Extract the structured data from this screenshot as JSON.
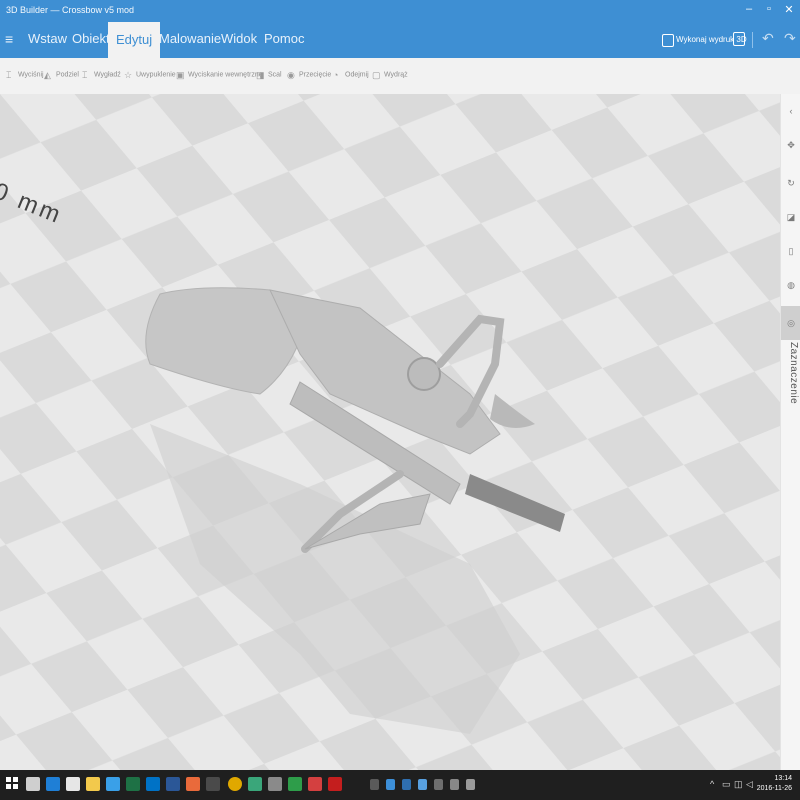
{
  "window": {
    "title": "3D Builder — Crossbow v5 mod",
    "controls": [
      "–",
      "▫",
      "✕"
    ]
  },
  "menu": {
    "hamburger": "≡",
    "tabs": [
      "Wstaw",
      "Obiekt",
      "Edytuj",
      "Malowanie",
      "Widok",
      "Pomoc"
    ],
    "active_tab": "Edytuj",
    "share_label": "Wykonaj wydruk 3D",
    "undo": "↶",
    "redo": "↷"
  },
  "toolbar": {
    "items": [
      {
        "label": "Wyciśnij",
        "icon": "extrude-icon"
      },
      {
        "label": "Podziel",
        "icon": "split-icon"
      },
      {
        "label": "Wygładź",
        "icon": "smooth-icon"
      },
      {
        "label": "Uwypuklenie",
        "icon": "emboss-icon"
      },
      {
        "label": "Wyciskanie wewnętrzne",
        "icon": "extrude-down-icon"
      },
      {
        "label": "Scal",
        "icon": "merge-icon"
      },
      {
        "label": "Przecięcie",
        "icon": "intersect-icon"
      },
      {
        "label": "Odejmij",
        "icon": "subtract-icon"
      },
      {
        "label": "Wydrąż",
        "icon": "hollow-icon"
      }
    ]
  },
  "viewport": {
    "ruler_label": "0 mm",
    "object": "crossbow",
    "grid_colors": [
      "#d9d9d9",
      "#e8e8e8"
    ],
    "model_color": "#c9c9c9"
  },
  "side_panel": {
    "icons": [
      "collapse-icon",
      "move-icon",
      "rotate-icon",
      "scale-icon",
      "lock-icon",
      "paint-icon",
      "select-icon"
    ],
    "label": "Zaznaczenie"
  },
  "taskbar": {
    "apps": [
      {
        "name": "task-view-icon",
        "color": "#cfcfcf"
      },
      {
        "name": "edge-icon",
        "color": "#1f7fd6"
      },
      {
        "name": "store-icon",
        "color": "#e6e6e6"
      },
      {
        "name": "explorer-icon",
        "color": "#f2c94c"
      },
      {
        "name": "3d-builder-icon",
        "color": "#3aa0e8"
      },
      {
        "name": "excel-icon",
        "color": "#1e7145"
      },
      {
        "name": "outlook-icon",
        "color": "#0072c6"
      },
      {
        "name": "word-icon",
        "color": "#2b5797"
      },
      {
        "name": "paint-icon",
        "color": "#e96a3b"
      },
      {
        "name": "photos-icon",
        "color": "#4a4a4a"
      },
      {
        "name": "chrome-icon",
        "color": "#e0a800"
      },
      {
        "name": "app-icon",
        "color": "#3aa67a"
      },
      {
        "name": "app2-icon",
        "color": "#8a8a8a"
      },
      {
        "name": "app3-icon",
        "color": "#2e9d4a"
      },
      {
        "name": "app4-icon",
        "color": "#d44040"
      },
      {
        "name": "acrobat-icon",
        "color": "#c41e1e"
      },
      {
        "name": "app5-icon",
        "color": "#5a5a5a"
      },
      {
        "name": "app6-icon",
        "color": "#3d8fd8"
      },
      {
        "name": "app7-icon",
        "color": "#2f6fb0"
      },
      {
        "name": "app8-icon",
        "color": "#58a0e0"
      },
      {
        "name": "app9-icon",
        "color": "#6e6e6e"
      },
      {
        "name": "app10-icon",
        "color": "#888888"
      },
      {
        "name": "app11-icon",
        "color": "#9a9a9a"
      }
    ],
    "time": "13:14",
    "date": "2016-11-26"
  }
}
